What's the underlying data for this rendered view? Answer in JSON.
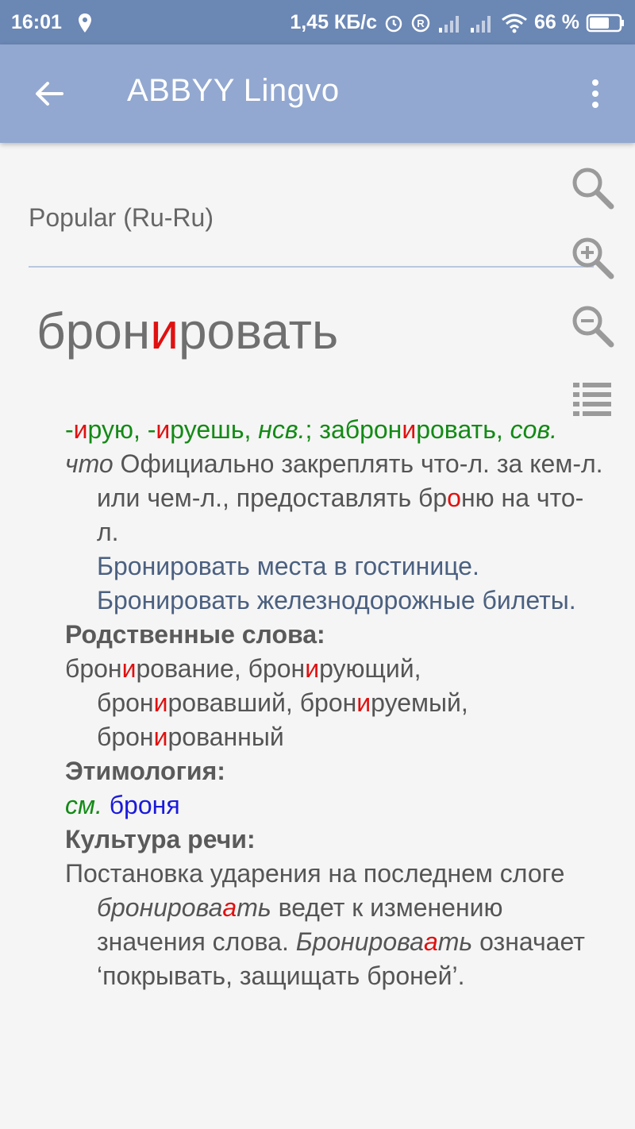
{
  "status_bar": {
    "time": "16:01",
    "speed": "1,45 КБ/с",
    "battery": "66 %"
  },
  "app_bar": {
    "title": "ABBYY Lingvo"
  },
  "search": {
    "value": "Popular (Ru-Ru)"
  },
  "headword": {
    "part1": "брон",
    "stress": "и",
    "part2": "ровать"
  },
  "article": {
    "forms": {
      "dash1": "-",
      "f1_stress": "и",
      "f1_rest": "рую, -",
      "f2_stress": "и",
      "f2_rest": "руешь, ",
      "aspect1": "нсв.",
      "sep": "; заброн",
      "f3_stress": "и",
      "f3_rest": "ровать,",
      "aspect2": "сов."
    },
    "definition": {
      "gram": "что",
      "text1": " Официально закреплять что-л. за кем-л. или чем-л., предоставлять бр",
      "stress": "о",
      "text2": "ню на что-л."
    },
    "examples": [
      "Бронировать места в гостинице.",
      "Бронировать железнодорожные билеты."
    ],
    "related_label": "Родственные слова:",
    "related": {
      "w1a": "брон",
      "w1s": "и",
      "w1b": "рование, брон",
      "w2s": "и",
      "w2b": "рующий, брон",
      "w3s": "и",
      "w3b": "ровавший, брон",
      "w4s": "и",
      "w4b": "руемый, брон",
      "w5s": "и",
      "w5b": "рованный"
    },
    "etymology_label": "Этимология:",
    "etymology": {
      "see": "см.",
      "link": "броня"
    },
    "culture_label": "Культура речи:",
    "culture": {
      "t1": "Постановка ударения на последнем слоге ",
      "w1a": "бронирова",
      "w1s": "а",
      "w1b": "ть",
      "t2": " ведет к изменению значения слова. ",
      "w2a": "Бронирова",
      "w2s": "а",
      "w2b": "ть",
      "t3": " означает ‘покрывать, защищать броней’."
    }
  }
}
